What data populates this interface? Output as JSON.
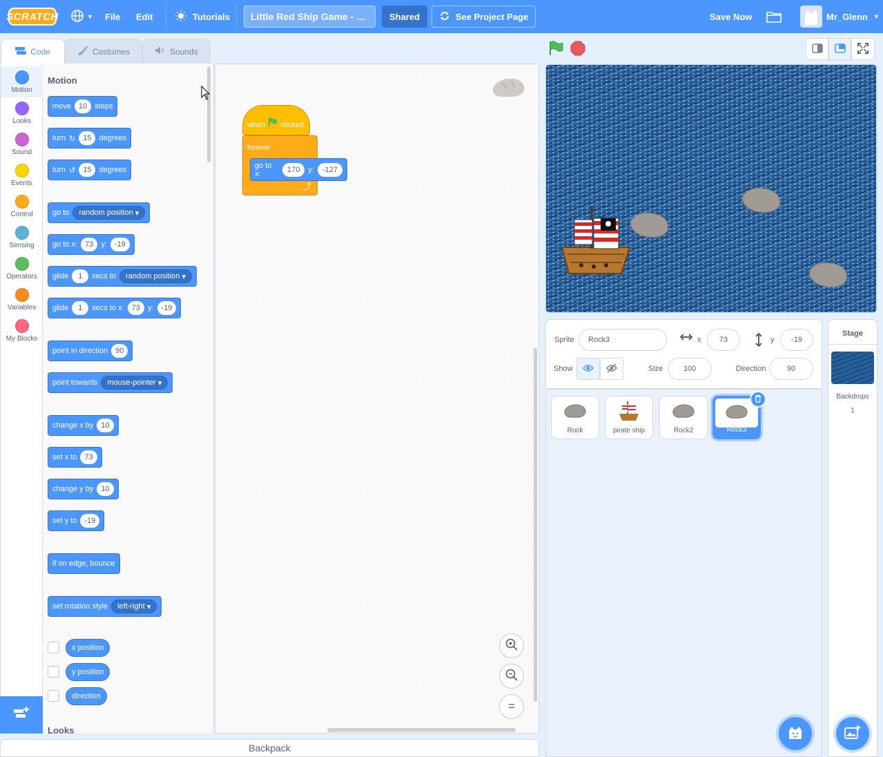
{
  "menubar": {
    "logo_text": "SCRATCH",
    "file": "File",
    "edit": "Edit",
    "tutorials": "Tutorials",
    "project_title": "Little Red Ship Game - du...",
    "shared": "Shared",
    "see_project_page": "See Project Page",
    "save_now": "Save Now",
    "username": "Mr_Glenn"
  },
  "tabs": {
    "code": "Code",
    "costumes": "Costumes",
    "sounds": "Sounds"
  },
  "categories": [
    {
      "label": "Motion",
      "color": "#4c97ff"
    },
    {
      "label": "Looks",
      "color": "#9966ff"
    },
    {
      "label": "Sound",
      "color": "#cf63cf"
    },
    {
      "label": "Events",
      "color": "#ffd500"
    },
    {
      "label": "Control",
      "color": "#ffab19"
    },
    {
      "label": "Sensing",
      "color": "#5cb1d6"
    },
    {
      "label": "Operators",
      "color": "#59c059"
    },
    {
      "label": "Variables",
      "color": "#ff8c1a"
    },
    {
      "label": "My Blocks",
      "color": "#ff6680"
    }
  ],
  "palette": {
    "motion_title": "Motion",
    "looks_title": "Looks",
    "move": {
      "a": "move",
      "n": "10",
      "b": "steps"
    },
    "turn_cw": {
      "a": "turn",
      "n": "15",
      "b": "degrees"
    },
    "turn_ccw": {
      "a": "turn",
      "n": "15",
      "b": "degrees"
    },
    "goto": {
      "a": "go to",
      "d": "random position"
    },
    "gotoxy": {
      "a": "go to x:",
      "x": "73",
      "y_label": "y:",
      "y": "-19"
    },
    "glide": {
      "a": "glide",
      "n": "1",
      "b": "secs to",
      "d": "random position"
    },
    "glidexy": {
      "a": "glide",
      "n": "1",
      "b": "secs to x:",
      "x": "73",
      "y_label": "y:",
      "y": "-19"
    },
    "point_dir": {
      "a": "point in direction",
      "n": "90"
    },
    "point_towards": {
      "a": "point towards",
      "d": "mouse-pointer"
    },
    "change_x": {
      "a": "change x by",
      "n": "10"
    },
    "set_x": {
      "a": "set x to",
      "n": "73"
    },
    "change_y": {
      "a": "change y by",
      "n": "10"
    },
    "set_y": {
      "a": "set y to",
      "n": "-19"
    },
    "bounce": "if on edge, bounce",
    "rotation": {
      "a": "set rotation style",
      "d": "left-right"
    },
    "x_position": "x position",
    "y_position": "y position",
    "direction": "direction"
  },
  "script": {
    "hat_when": "when",
    "hat_clicked": "clicked",
    "forever": "forever",
    "goto_label": "go to x:",
    "goto_x": "170",
    "goto_y_label": "y:",
    "goto_y": "-127"
  },
  "zoom": {
    "in": "+",
    "out": "−",
    "reset": "="
  },
  "backpack": "Backpack",
  "sprite_info": {
    "sprite_label": "Sprite",
    "sprite_name": "Rock3",
    "x_label": "x",
    "x_value": "73",
    "y_label": "y",
    "y_value": "-19",
    "show_label": "Show",
    "size_label": "Size",
    "size_value": "100",
    "direction_label": "Direction",
    "direction_value": "90"
  },
  "sprites": [
    {
      "name": "Rock"
    },
    {
      "name": "pirate ship"
    },
    {
      "name": "Rock2"
    },
    {
      "name": "Rock3"
    }
  ],
  "stage_panel": {
    "title": "Stage",
    "backdrops_label": "Backdrops",
    "backdrops_count": "1"
  }
}
